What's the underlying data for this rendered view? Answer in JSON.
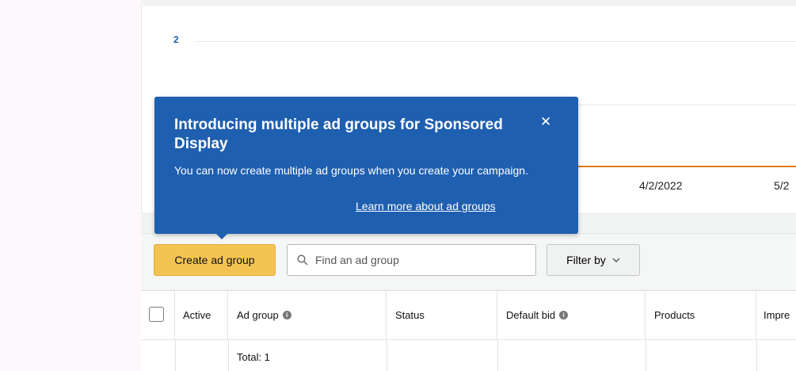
{
  "chart": {
    "y_tick": "2",
    "x_ticks": [
      "4/2/2022",
      "5/2"
    ],
    "series_color": "#e07b12"
  },
  "popover": {
    "title": "Introducing multiple ad groups for Sponsored Display",
    "body": "You can now create multiple ad groups when you create your campaign.",
    "link": "Learn more about ad groups",
    "close_icon": "close-icon",
    "background": "#1f5fb0"
  },
  "toolbar": {
    "create_label": "Create ad group",
    "search_placeholder": "Find an ad group",
    "filter_label": "Filter by",
    "accent": "#f4c453"
  },
  "table": {
    "columns": [
      "Active",
      "Ad group",
      "Status",
      "Default bid",
      "Products",
      "Impre"
    ],
    "total_label": "Total: 1"
  }
}
